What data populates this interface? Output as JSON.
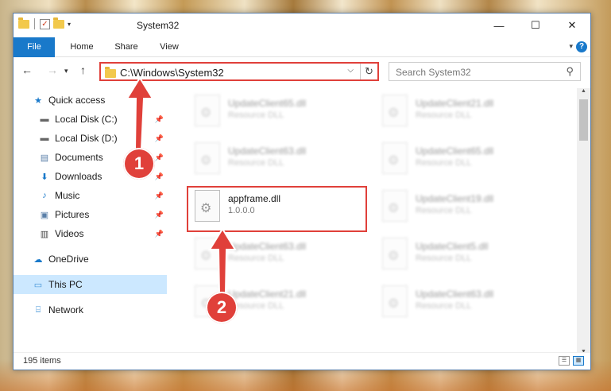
{
  "window": {
    "title": "System32",
    "controls": {
      "minimize": "—",
      "maximize": "☐",
      "close": "✕"
    }
  },
  "ribbon": {
    "tabs": [
      "File",
      "Home",
      "Share",
      "View"
    ],
    "help": "?"
  },
  "address": {
    "path": "C:\\Windows\\System32",
    "search_placeholder": "Search System32"
  },
  "navigation": {
    "items": [
      {
        "label": "Quick access",
        "icon": "star-icon",
        "pinned": false
      },
      {
        "label": "Local Disk (C:)",
        "icon": "drive-icon",
        "pinned": true
      },
      {
        "label": "Local Disk (D:)",
        "icon": "drive-icon",
        "pinned": true
      },
      {
        "label": "Documents",
        "icon": "documents-icon",
        "pinned": true
      },
      {
        "label": "Downloads",
        "icon": "download-icon",
        "pinned": true
      },
      {
        "label": "Music",
        "icon": "music-icon",
        "pinned": true
      },
      {
        "label": "Pictures",
        "icon": "pictures-icon",
        "pinned": true
      },
      {
        "label": "Videos",
        "icon": "videos-icon",
        "pinned": true
      },
      {
        "label": "OneDrive",
        "icon": "cloud-icon",
        "pinned": false
      },
      {
        "label": "This PC",
        "icon": "pc-icon",
        "pinned": false,
        "selected": true
      },
      {
        "label": "Network",
        "icon": "network-icon",
        "pinned": false
      }
    ]
  },
  "files": [
    {
      "name": "UpdateClient65.dll",
      "type": "Resource DLL",
      "blurred": true
    },
    {
      "name": "UpdateClient21.dll",
      "type": "Resource DLL",
      "blurred": true
    },
    {
      "name": "UpdateClient63.dll",
      "type": "Resource DLL",
      "blurred": true
    },
    {
      "name": "UpdateClient65.dll",
      "type": "Resource DLL",
      "blurred": true
    },
    {
      "name": "appframe.dll",
      "type": "1.0.0.0",
      "blurred": false,
      "highlighted": true
    },
    {
      "name": "UpdateClient19.dll",
      "type": "Resource DLL",
      "blurred": true
    },
    {
      "name": "UpdateClient63.dll",
      "type": "Resource DLL",
      "blurred": true
    },
    {
      "name": "UpdateClient5.dll",
      "type": "Resource DLL",
      "blurred": true
    },
    {
      "name": "UpdateClient21.dll",
      "type": "Resource DLL",
      "blurred": true
    },
    {
      "name": "UpdateClient63.dll",
      "type": "Resource DLL",
      "blurred": true
    }
  ],
  "status": {
    "item_count": "195 items"
  },
  "callouts": {
    "first": "1",
    "second": "2"
  },
  "colors": {
    "accent": "#1979ca",
    "highlight": "#e0403a",
    "selected_nav": "#cce8ff"
  }
}
